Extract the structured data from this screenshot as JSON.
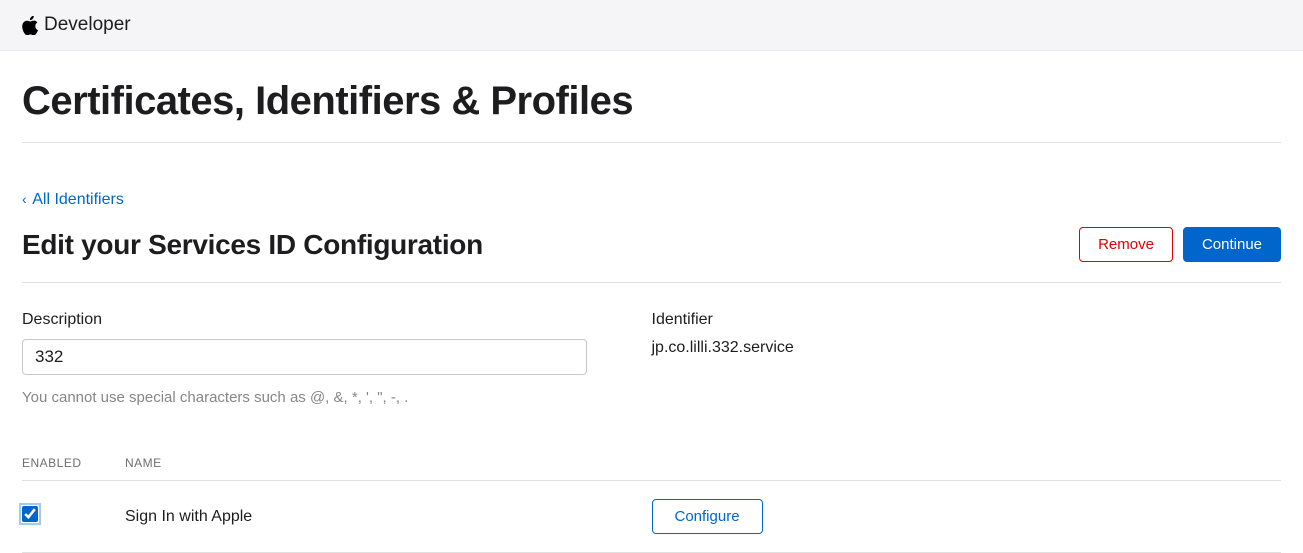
{
  "header": {
    "brand": "Developer"
  },
  "page": {
    "title": "Certificates, Identifiers & Profiles",
    "back_link": "All Identifiers",
    "subtitle": "Edit your Services ID Configuration"
  },
  "buttons": {
    "remove": "Remove",
    "continue": "Continue",
    "configure": "Configure"
  },
  "form": {
    "description_label": "Description",
    "description_value": "332",
    "description_help": "You cannot use special characters such as @, &, *, ', \", -, .",
    "identifier_label": "Identifier",
    "identifier_value": "jp.co.lilli.332.service"
  },
  "capabilities": {
    "header_enabled": "ENABLED",
    "header_name": "NAME",
    "items": [
      {
        "name": "Sign In with Apple",
        "enabled": true,
        "configurable": true
      }
    ]
  }
}
